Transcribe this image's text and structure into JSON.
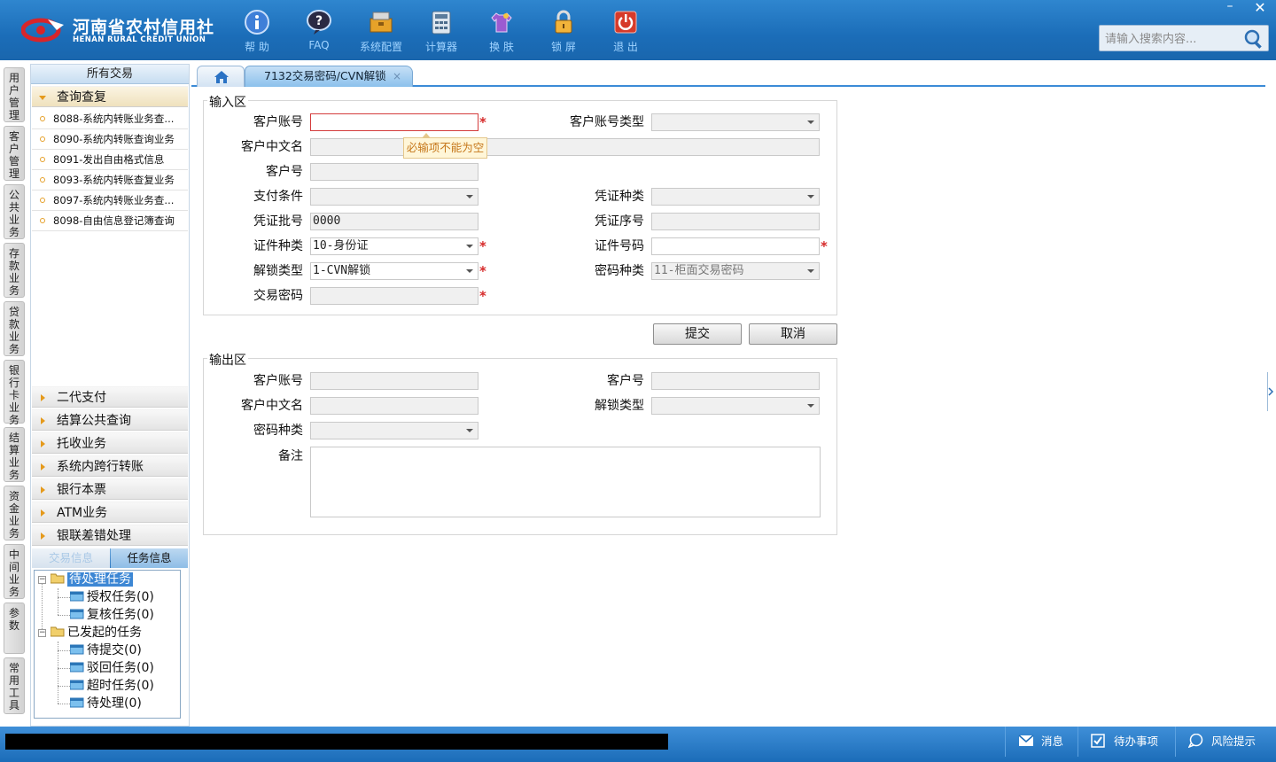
{
  "header": {
    "logo_cn": "河南省农村信用社",
    "logo_en": "HENAN RURAL CREDIT UNION",
    "tools": [
      "帮 助",
      "FAQ",
      "系统配置",
      "计算器",
      "换 肤",
      "锁 屏",
      "退 出"
    ],
    "window_min": "–",
    "window_close": "✕",
    "search_placeholder": "请输入搜索内容..."
  },
  "vtabs": [
    "用户管理",
    "客户管理",
    "公共业务",
    "存款业务",
    "贷款业务",
    "银行卡业务",
    "结算业务",
    "资金业务",
    "中间业务",
    "参数",
    "常用工具"
  ],
  "left_panel": {
    "title": "所有交易",
    "open_section": "查询查复",
    "items": [
      "8088-系统内转账业务查...",
      "8090-系统内转账查询业务",
      "8091-发出自由格式信息",
      "8093-系统内转账查复业务",
      "8097-系统内转账业务查...",
      "8098-自由信息登记簿查询"
    ],
    "sections": [
      "二代支付",
      "结算公共查询",
      "托收业务",
      "系统内跨行转账",
      "银行本票",
      "ATM业务",
      "银联差错处理"
    ],
    "info_tabs": [
      "交易信息",
      "任务信息"
    ],
    "tree": {
      "pending": "待处理任务",
      "auth": "授权任务(0)",
      "review": "复核任务(0)",
      "initiated": "已发起的任务",
      "to_submit": "待提交(0)",
      "rejected": "驳回任务(0)",
      "timeout": "超时任务(0)",
      "to_process": "待处理(0)"
    }
  },
  "tabs": {
    "current": "7132交易密码/CVN解锁",
    "close": "×"
  },
  "input_area": {
    "legend": "输入区",
    "labels": {
      "account": "客户账号",
      "account_type": "客户账号类型",
      "cn_name": "客户中文名",
      "customer_no": "客户号",
      "pay_cond": "支付条件",
      "voucher_type": "凭证种类",
      "voucher_batch": "凭证批号",
      "voucher_seq": "凭证序号",
      "id_type": "证件种类",
      "id_no": "证件号码",
      "unlock_type": "解锁类型",
      "pwd_type": "密码种类",
      "trade_pwd": "交易密码"
    },
    "values": {
      "account": "",
      "voucher_batch": "0000",
      "id_type": "10-身份证",
      "unlock_type": "1-CVN解锁",
      "pwd_type": "11-柜面交易密码"
    },
    "required_mark": "*",
    "error_tip": "必输项不能为空"
  },
  "buttons": {
    "submit": "提交",
    "cancel": "取消"
  },
  "output_area": {
    "legend": "输出区",
    "labels": {
      "account": "客户账号",
      "customer_no": "客户号",
      "cn_name": "客户中文名",
      "unlock_type": "解锁类型",
      "pwd_type": "密码种类",
      "remark": "备注"
    }
  },
  "statusbar": {
    "message": "消息",
    "todo": "待办事项",
    "risk": "风险提示"
  }
}
